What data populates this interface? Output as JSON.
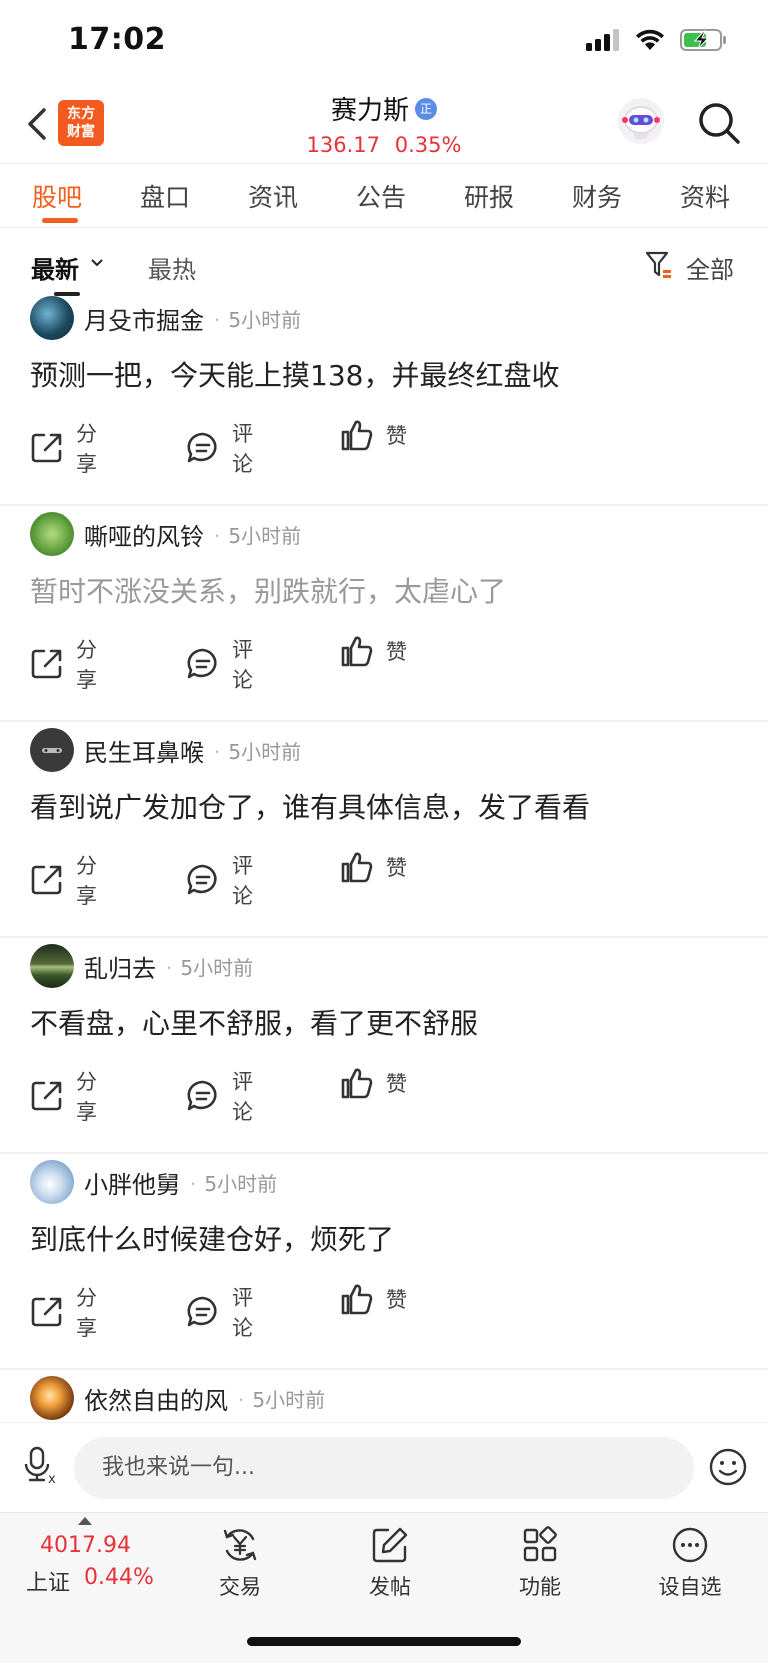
{
  "status_bar": {
    "time": "17:02"
  },
  "header": {
    "logo_line1": "东方",
    "logo_line2": "财富",
    "stock_name": "赛力斯",
    "verify_badge": "正",
    "price": "136.17",
    "change_pct": "0.35%"
  },
  "tabs": [
    {
      "label": "股吧",
      "active": true
    },
    {
      "label": "盘口"
    },
    {
      "label": "资讯"
    },
    {
      "label": "公告"
    },
    {
      "label": "研报"
    },
    {
      "label": "财务"
    },
    {
      "label": "资料"
    }
  ],
  "sort": {
    "latest": "最新",
    "hot": "最热",
    "filter": "全部"
  },
  "posts": [
    {
      "user": "月殳市掘金",
      "time": "5小时前",
      "text": "预测一把，今天能上摸138，并最终红盘收",
      "read": false,
      "avatar_color": "#1e4a60"
    },
    {
      "user": "嘶哑的风铃",
      "time": "5小时前",
      "text": "暂时不涨没关系，别跌就行，太虐心了",
      "read": true,
      "avatar_color": "#5a9a3a"
    },
    {
      "user": "民生耳鼻喉",
      "time": "5小时前",
      "text": "看到说广发加仓了，谁有具体信息，发了看看",
      "read": false,
      "avatar_color": "#3a3a3a"
    },
    {
      "user": "乱归去",
      "time": "5小时前",
      "text": "不看盘，心里不舒服，看了更不舒服",
      "read": false,
      "avatar_color": "#3d5a2a"
    },
    {
      "user": "小胖他舅",
      "time": "5小时前",
      "text": "到底什么时候建仓好，烦死了",
      "read": false,
      "avatar_color": "#8aaed0"
    },
    {
      "user": "依然自由的风",
      "time": "5小时前",
      "text": "",
      "read": false,
      "avatar_color": "#c8772a"
    }
  ],
  "actions": {
    "share": "分享",
    "comment": "评论",
    "like": "赞"
  },
  "input": {
    "placeholder": "我也来说一句..."
  },
  "bottom_nav": {
    "index_value": "4017.94",
    "index_name": "上证",
    "index_change": "0.44%",
    "items": [
      {
        "label": "交易",
        "icon": "yen-cycle-icon"
      },
      {
        "label": "发帖",
        "icon": "edit-icon"
      },
      {
        "label": "功能",
        "icon": "grid-icon"
      },
      {
        "label": "设自选",
        "icon": "more-icon"
      }
    ]
  },
  "colors": {
    "accent": "#f0601f",
    "up": "#e8323b",
    "logo": "#f25a1f"
  }
}
